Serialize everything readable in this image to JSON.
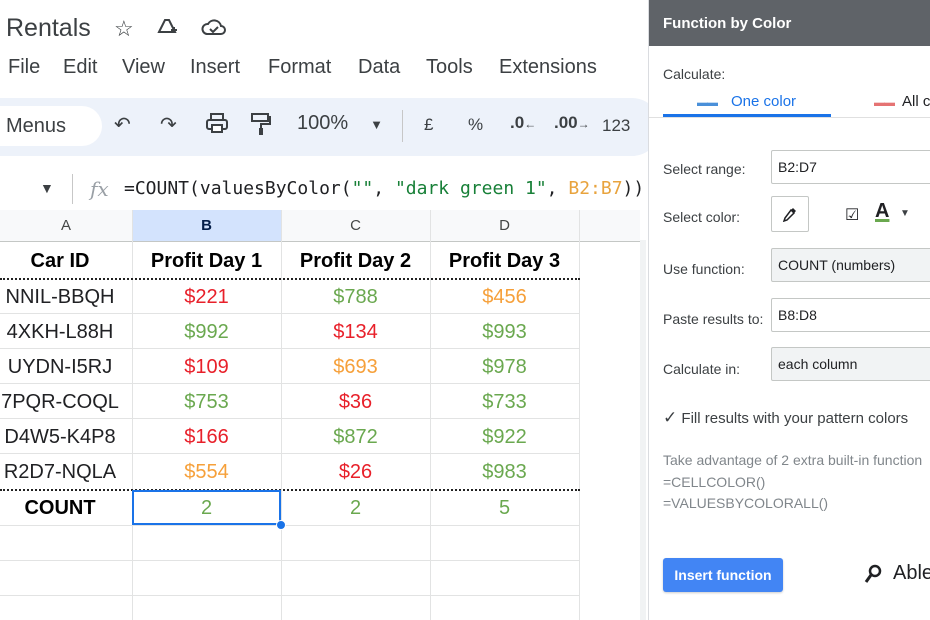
{
  "app": {
    "doc_title": "Rentals",
    "menu": [
      "File",
      "Edit",
      "View",
      "Insert",
      "Format",
      "Data",
      "Tools",
      "Extensions"
    ]
  },
  "toolbar": {
    "menus_label": "Menus",
    "zoom": "100%",
    "currency": "£",
    "percent": "%",
    "dec_decrease": ".0",
    "dec_increase": ".00",
    "number_format": "123"
  },
  "formula_bar": {
    "fx": "fx",
    "prefix": "=COUNT(valuesByColor(",
    "arg1": "\"\"",
    "sep1": ", ",
    "arg2": "\"dark green 1\"",
    "sep2": ", ",
    "arg3": "B2:B7",
    "suffix": "))"
  },
  "sheet": {
    "columns": [
      "A",
      "B",
      "C",
      "D"
    ],
    "headers": [
      "Car ID",
      "Profit Day 1",
      "Profit Day 2",
      "Profit Day 3"
    ],
    "rows": [
      {
        "id": "NNIL-BBQH",
        "d1": "$221",
        "d2": "$788",
        "d3": "$456"
      },
      {
        "id": "4XKH-L88H",
        "d1": "$992",
        "d2": "$134",
        "d3": "$993"
      },
      {
        "id": "UYDN-I5RJ",
        "d1": "$109",
        "d2": "$693",
        "d3": "$978"
      },
      {
        "id": "7PQR-COQL",
        "d1": "$753",
        "d2": "$36",
        "d3": "$733"
      },
      {
        "id": "D4W5-K4P8",
        "d1": "$166",
        "d2": "$872",
        "d3": "$922"
      },
      {
        "id": "R2D7-NQLA",
        "d1": "$554",
        "d2": "$26",
        "d3": "$983"
      }
    ],
    "colors": {
      "red": "#e8202a",
      "green": "#6aa84f",
      "orange": "#f6a03a"
    },
    "total": {
      "label": "COUNT",
      "d1": "2",
      "d2": "2",
      "d3": "5"
    }
  },
  "panel": {
    "title": "Function by Color",
    "calculate_label": "Calculate:",
    "tab_one": "One color",
    "tab_all": "All co",
    "select_range_label": "Select range:",
    "select_range_value": "B2:D7",
    "select_color_label": "Select color:",
    "font_color_letter": "A",
    "use_function_label": "Use function:",
    "use_function_value": "COUNT (numbers)",
    "paste_label": "Paste results to:",
    "paste_value": "B8:D8",
    "calc_in_label": "Calculate in:",
    "calc_in_value": "each column",
    "fill_label": "Fill results with your pattern colors",
    "info_line": "Take advantage of 2 extra built-in function",
    "info_fn1": "=CELLCOLOR()",
    "info_fn2": "=VALUESBYCOLORALL()",
    "insert_button": "Insert function",
    "brand": "Able"
  }
}
